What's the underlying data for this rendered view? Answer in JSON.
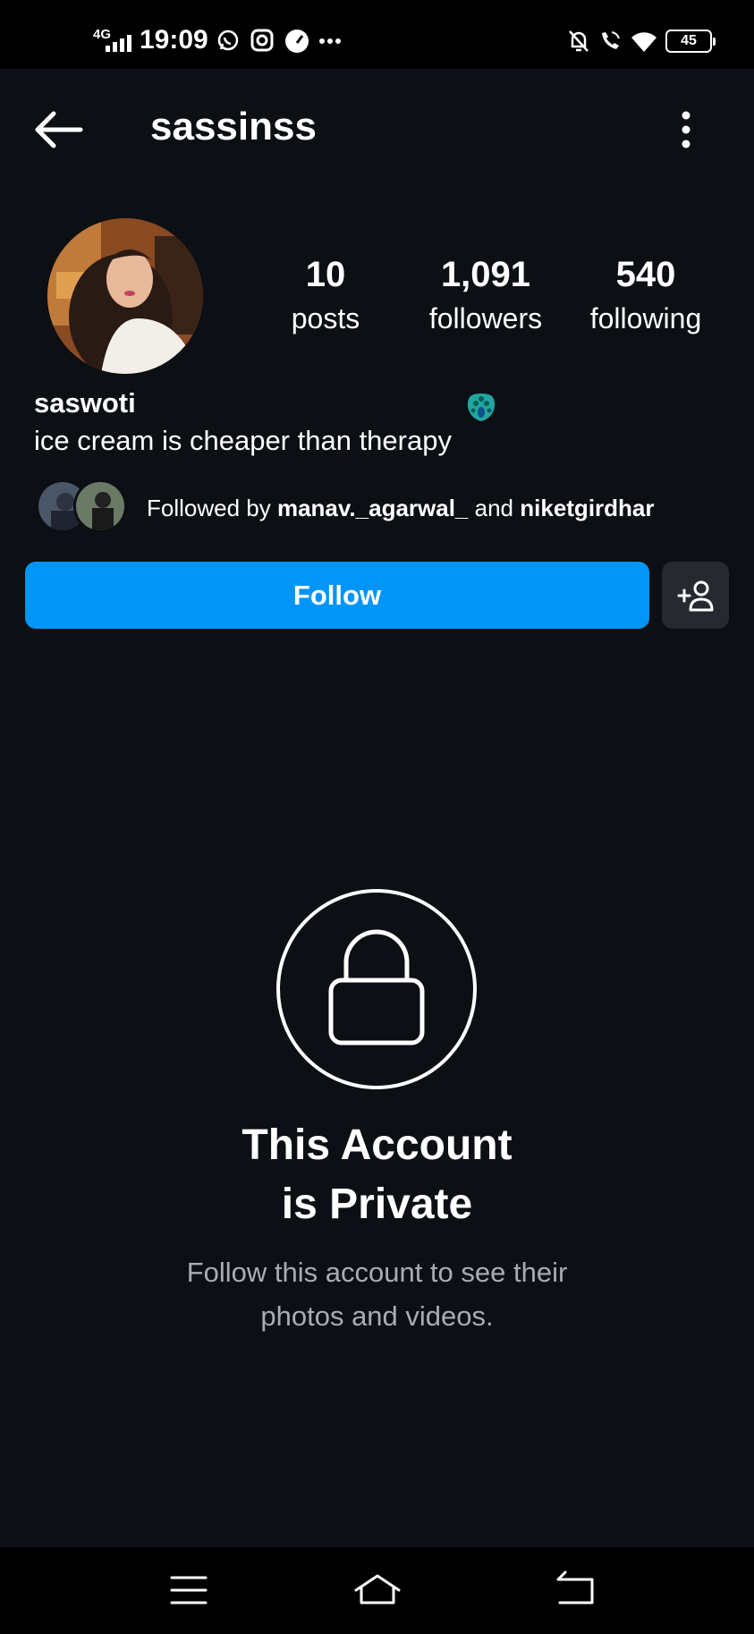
{
  "status_bar": {
    "network": "4G",
    "time": "19:09",
    "battery": "45",
    "icons": [
      "whatsapp-icon",
      "instagram-icon",
      "speed-icon",
      "more-dots-icon",
      "notifications-off-icon",
      "wifi-calling-icon",
      "wifi-icon",
      "battery-icon"
    ]
  },
  "header": {
    "username": "sassinss",
    "back_icon": "arrow-left-icon",
    "menu_icon": "more-vertical-icon"
  },
  "profile": {
    "display_name": "saswoti",
    "bio": "ice cream is cheaper than therapy",
    "badge_icon": "peacock-icon",
    "stats": {
      "posts": {
        "count": "10",
        "label": "posts"
      },
      "followers": {
        "count": "1,091",
        "label": "followers"
      },
      "following": {
        "count": "540",
        "label": "following"
      }
    },
    "followed_by": {
      "prefix": "Followed by",
      "user1": "manav._agarwal_",
      "joiner": "and",
      "user2": "niketgirdhar"
    }
  },
  "actions": {
    "follow_label": "Follow",
    "suggest_icon": "add-person-icon"
  },
  "private_notice": {
    "icon": "lock-icon",
    "title_line1": "This Account",
    "title_line2": "is Private",
    "subtitle_line1": "Follow this account to see their",
    "subtitle_line2": "photos and videos."
  },
  "nav_bar": {
    "icons": [
      "menu-icon",
      "home-icon",
      "back-icon"
    ]
  },
  "colors": {
    "background": "#0c0f14",
    "follow_button": "#0095f6",
    "secondary_button": "#262a30",
    "muted_text": "#a8acb3"
  }
}
